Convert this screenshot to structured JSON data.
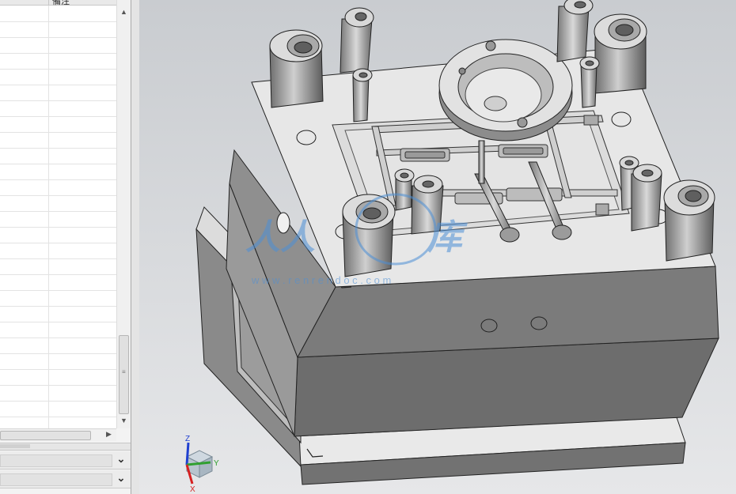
{
  "navigator": {
    "column_header": "備注"
  },
  "watermark": {
    "url": "w w w . r e n r e n d o c . c o m"
  },
  "triad": {
    "x": "X",
    "y": "Y",
    "z": "Z"
  },
  "colors": {
    "background_top": "#c9ccd0",
    "background_bottom": "#e6e7e9",
    "axis_x": "#d62020",
    "axis_y": "#30a030",
    "axis_z": "#2040d0",
    "watermark": "#4c8fd6"
  }
}
